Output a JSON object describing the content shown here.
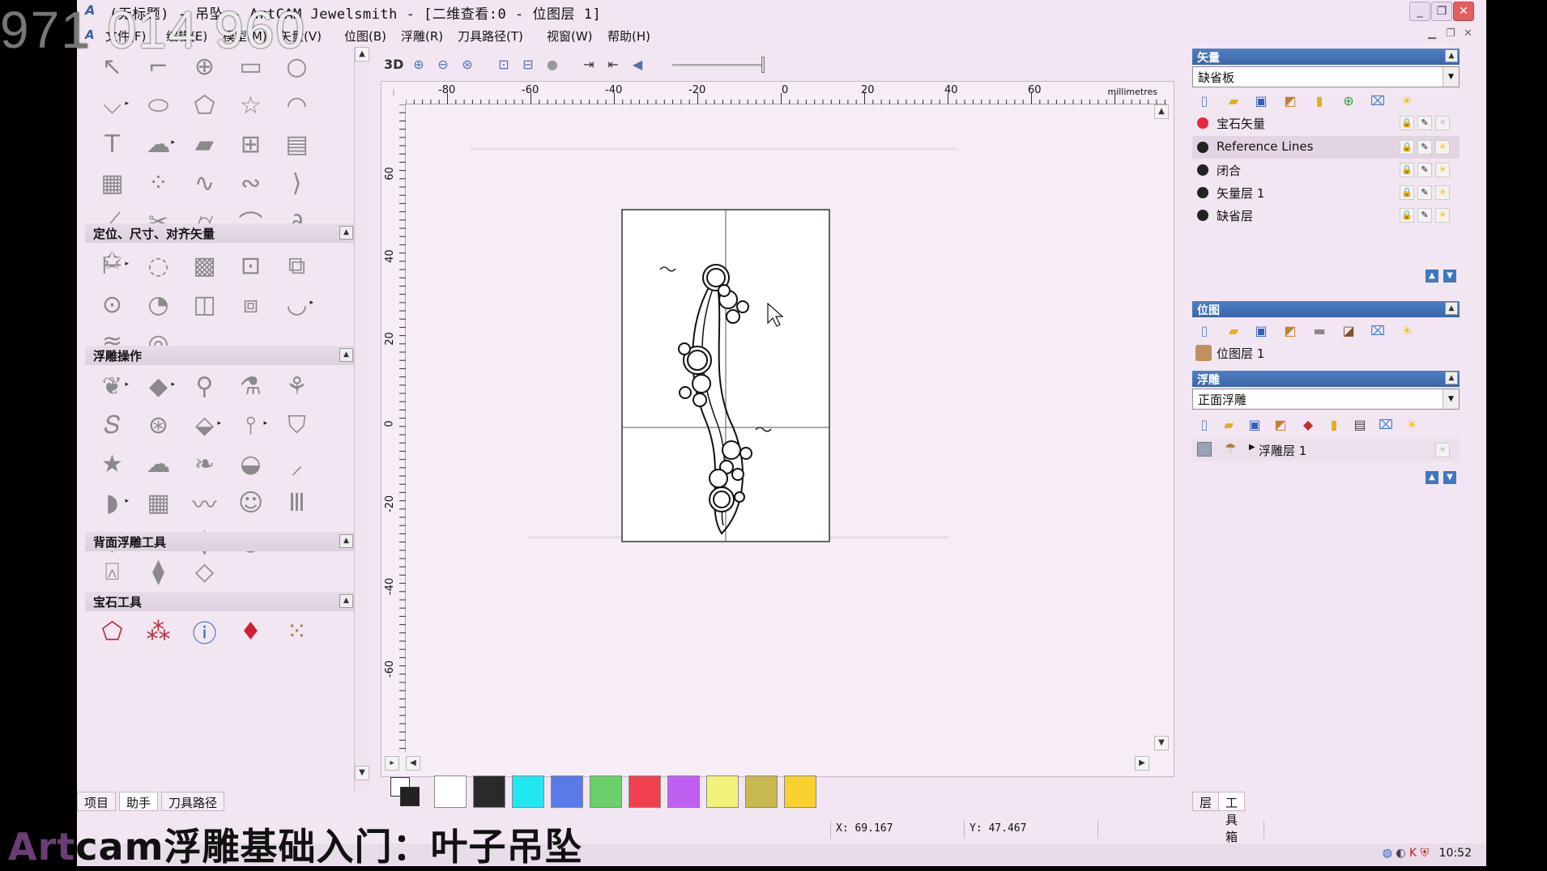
{
  "overlay": {
    "number_prefix": "971",
    "number_rest": " 014 960",
    "caption_prefix": "Art",
    "caption_rest": "cam浮雕基础入门：叶子吊坠"
  },
  "window": {
    "title": "(无标题) - 吊坠 - ArtCAM Jewelsmith - [二维查看:0 - 位图层 1]",
    "min": "_",
    "max": "❐",
    "close": "✕"
  },
  "menu": {
    "items": [
      "文件(F)",
      "编辑(E)",
      "模型(M)",
      "矢量(V)",
      "位图(B)",
      "浮雕(R)",
      "刀具路径(T)",
      "视窗(W)",
      "帮助(H)"
    ]
  },
  "left_panel": {
    "sections": {
      "position": "定位、尺寸、对齐矢量",
      "relief_ops": "浮雕操作",
      "back_relief": "背面浮雕工具",
      "gem": "宝石工具"
    },
    "tabs": [
      "项目",
      "助手",
      "刀具路径"
    ]
  },
  "view_toolbar": {
    "label_3d": "3D"
  },
  "ruler": {
    "unit": "millimetres",
    "h_ticks": [
      "-80",
      "-60",
      "-40",
      "-20",
      "0",
      "20",
      "40",
      "60"
    ],
    "v_ticks": [
      "60",
      "40",
      "20",
      "0",
      "-20",
      "-40",
      "-60"
    ]
  },
  "palette": {
    "colors": [
      "#ffffff",
      "#2a2a2a",
      "#22e6f0",
      "#5a7ae8",
      "#6ad06a",
      "#ef4050",
      "#c060f0",
      "#f2f27a",
      "#c8b850",
      "#f8d030"
    ]
  },
  "vector_panel": {
    "header": "矢量",
    "select": "缺省板",
    "layers": [
      {
        "name": "宝石矢量",
        "color": "#e8283c"
      },
      {
        "name": "Reference Lines",
        "color": "#222222"
      },
      {
        "name": "闭合",
        "color": "#222222"
      },
      {
        "name": "矢量层 1",
        "color": "#222222"
      },
      {
        "name": "缺省层",
        "color": "#222222"
      }
    ]
  },
  "bitmap_panel": {
    "header": "位图",
    "layer": "位图层 1"
  },
  "relief_panel": {
    "header": "浮雕",
    "select": "正面浮雕",
    "layer": "浮雕层 1"
  },
  "right_tabs": [
    "层",
    "工具箱"
  ],
  "status": {
    "x": "X: 69.167",
    "y": "Y: 47.467"
  },
  "taskbar": {
    "time": "10:52"
  }
}
